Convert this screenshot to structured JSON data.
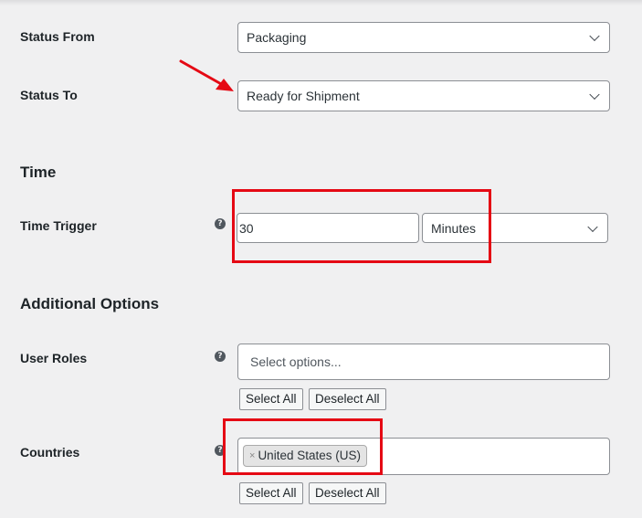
{
  "fields": {
    "status_from": {
      "label": "Status From",
      "value": "Packaging"
    },
    "status_to": {
      "label": "Status To",
      "value": "Ready for Shipment"
    }
  },
  "time_section": {
    "title": "Time",
    "trigger_label": "Time Trigger",
    "trigger_value": "30",
    "trigger_unit": "Minutes"
  },
  "additional_section": {
    "title": "Additional Options",
    "user_roles": {
      "label": "User Roles",
      "placeholder": "Select options...",
      "select_all": "Select All",
      "deselect_all": "Deselect All"
    },
    "countries": {
      "label": "Countries",
      "selected_chip": "United States (US)",
      "chip_remove": "×",
      "select_all": "Select All",
      "deselect_all": "Deselect All"
    }
  },
  "help_glyph": "?",
  "icons": [
    "chevron-down-icon",
    "help-icon",
    "remove-icon"
  ],
  "colors": {
    "annotation_red": "#e50914",
    "background": "#f0f0f1",
    "border": "#8c8f94"
  }
}
